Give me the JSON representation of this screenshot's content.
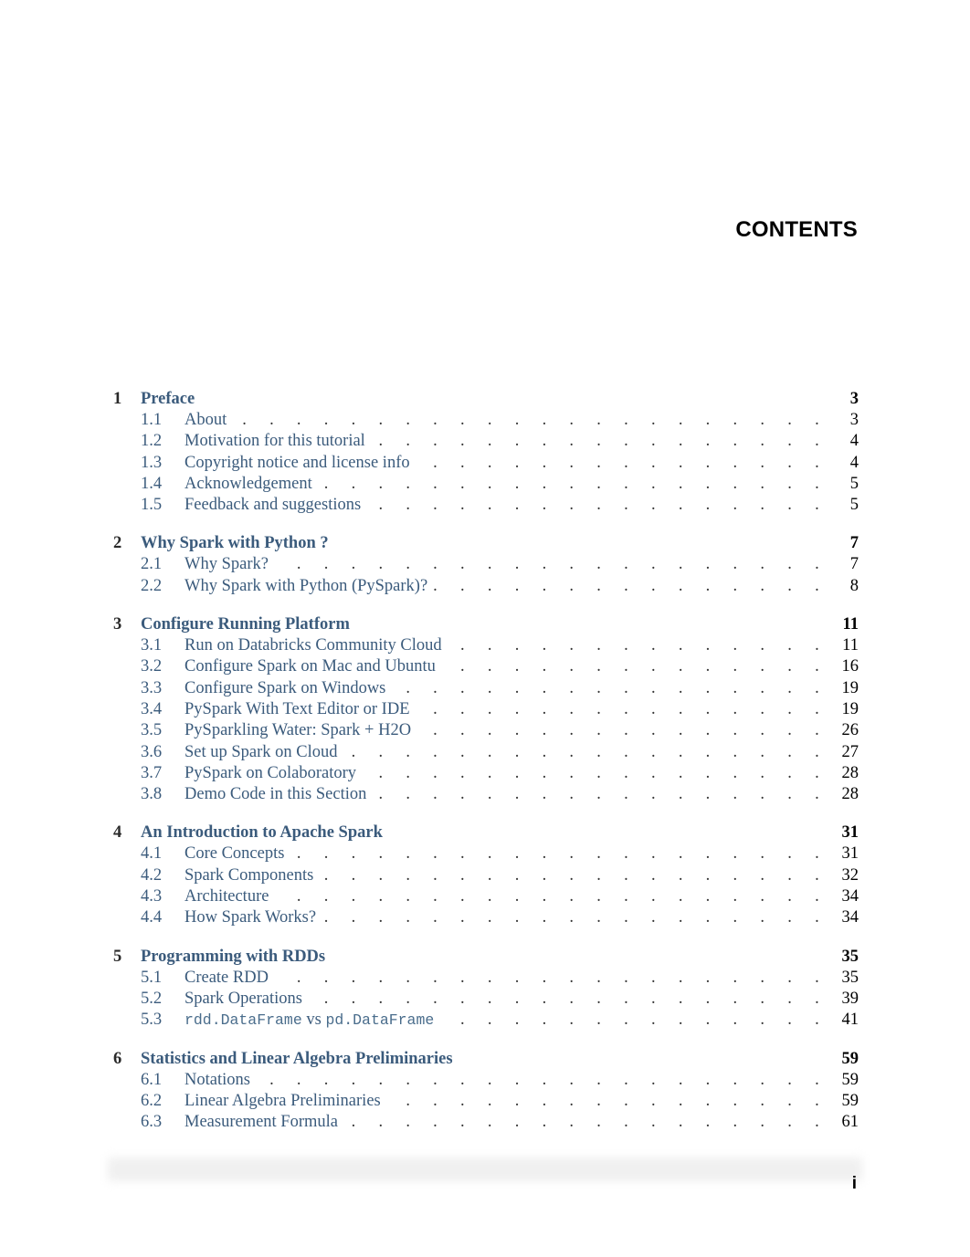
{
  "header": {
    "title": "CONTENTS"
  },
  "toc": [
    {
      "num": "1",
      "title": "Preface",
      "page": "3",
      "sections": [
        {
          "num": "1.1",
          "title": "About",
          "page": "3"
        },
        {
          "num": "1.2",
          "title": "Motivation for this tutorial",
          "page": "4"
        },
        {
          "num": "1.3",
          "title": "Copyright notice and license info",
          "page": "4"
        },
        {
          "num": "1.4",
          "title": "Acknowledgement",
          "page": "5"
        },
        {
          "num": "1.5",
          "title": "Feedback and suggestions",
          "page": "5"
        }
      ]
    },
    {
      "num": "2",
      "title": "Why Spark with Python ?",
      "page": "7",
      "sections": [
        {
          "num": "2.1",
          "title": "Why Spark?",
          "page": "7"
        },
        {
          "num": "2.2",
          "title": "Why Spark with Python (PySpark)?",
          "page": "8"
        }
      ]
    },
    {
      "num": "3",
      "title": "Configure Running Platform",
      "page": "11",
      "sections": [
        {
          "num": "3.1",
          "title": "Run on Databricks Community Cloud",
          "page": "11"
        },
        {
          "num": "3.2",
          "title": "Configure Spark on Mac and Ubuntu",
          "page": "16"
        },
        {
          "num": "3.3",
          "title": "Configure Spark on Windows",
          "page": "19"
        },
        {
          "num": "3.4",
          "title": "PySpark With Text Editor or IDE",
          "page": "19"
        },
        {
          "num": "3.5",
          "title": "PySparkling Water: Spark + H2O",
          "page": "26"
        },
        {
          "num": "3.6",
          "title": "Set up Spark on Cloud",
          "page": "27"
        },
        {
          "num": "3.7",
          "title": "PySpark on Colaboratory",
          "page": "28"
        },
        {
          "num": "3.8",
          "title": "Demo Code in this Section",
          "page": "28"
        }
      ]
    },
    {
      "num": "4",
      "title": "An Introduction to Apache Spark",
      "page": "31",
      "sections": [
        {
          "num": "4.1",
          "title": "Core Concepts",
          "page": "31"
        },
        {
          "num": "4.2",
          "title": "Spark Components",
          "page": "32"
        },
        {
          "num": "4.3",
          "title": "Architecture",
          "page": "34"
        },
        {
          "num": "4.4",
          "title": "How Spark Works?",
          "page": "34"
        }
      ]
    },
    {
      "num": "5",
      "title": "Programming with RDDs",
      "page": "35",
      "sections": [
        {
          "num": "5.1",
          "title": "Create RDD",
          "page": "35"
        },
        {
          "num": "5.2",
          "title": "Spark Operations",
          "page": "39"
        },
        {
          "num": "5.3",
          "title_parts": [
            "rdd.DataFrame",
            " vs ",
            "pd.DataFrame"
          ],
          "page": "41"
        }
      ]
    },
    {
      "num": "6",
      "title": "Statistics and Linear Algebra Preliminaries",
      "page": "59",
      "sections": [
        {
          "num": "6.1",
          "title": "Notations",
          "page": "59"
        },
        {
          "num": "6.2",
          "title": "Linear Algebra Preliminaries",
          "page": "59"
        },
        {
          "num": "6.3",
          "title": "Measurement Formula",
          "page": "61"
        }
      ]
    }
  ],
  "footer": {
    "page_label": "i"
  }
}
